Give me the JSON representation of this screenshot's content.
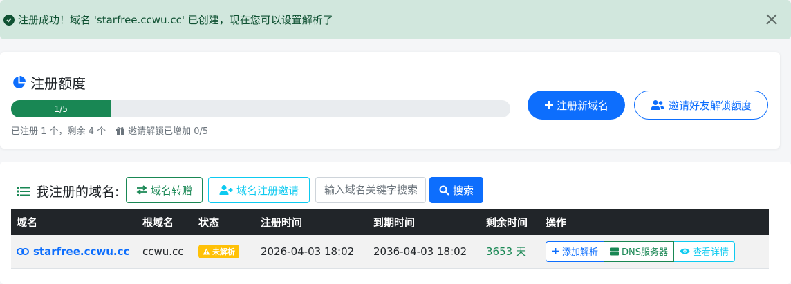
{
  "alert": {
    "message": "注册成功！域名 'starfree.ccwu.cc' 已创建，现在您可以设置解析了",
    "color": "#0f5132",
    "background": "#d1e7dd"
  },
  "quota": {
    "title": "注册额度",
    "progress_label": "1/5",
    "progress_fraction": 0.2,
    "info": "已注册 1 个，剩余 4 个",
    "invite_info": "邀请解锁已增加 0/5",
    "register_button": "注册新域名",
    "invite_button": "邀请好友解锁额度"
  },
  "domains": {
    "title": "我注册的域名:",
    "transfer_button": "域名转赠",
    "invite_button": "域名注册邀请",
    "search_placeholder": "输入域名关键字搜索",
    "search_button": "搜索",
    "headers": [
      "域名",
      "根域名",
      "状态",
      "注册时间",
      "到期时间",
      "剩余时间",
      "操作"
    ],
    "rows": [
      {
        "domain": "starfree.ccwu.cc",
        "root": "ccwu.cc",
        "status": "未解析",
        "registered": "2026-04-03 18:02",
        "expires": "2036-04-03 18:02",
        "remaining": "3653 天",
        "actions": {
          "add": "添加解析",
          "dns": "DNS服务器",
          "view": "查看详情"
        }
      }
    ]
  },
  "colors": {
    "primary": "#0d6efd",
    "success": "#198754",
    "info": "#0dcaf0",
    "warning": "#ffc107",
    "dark": "#212529"
  }
}
